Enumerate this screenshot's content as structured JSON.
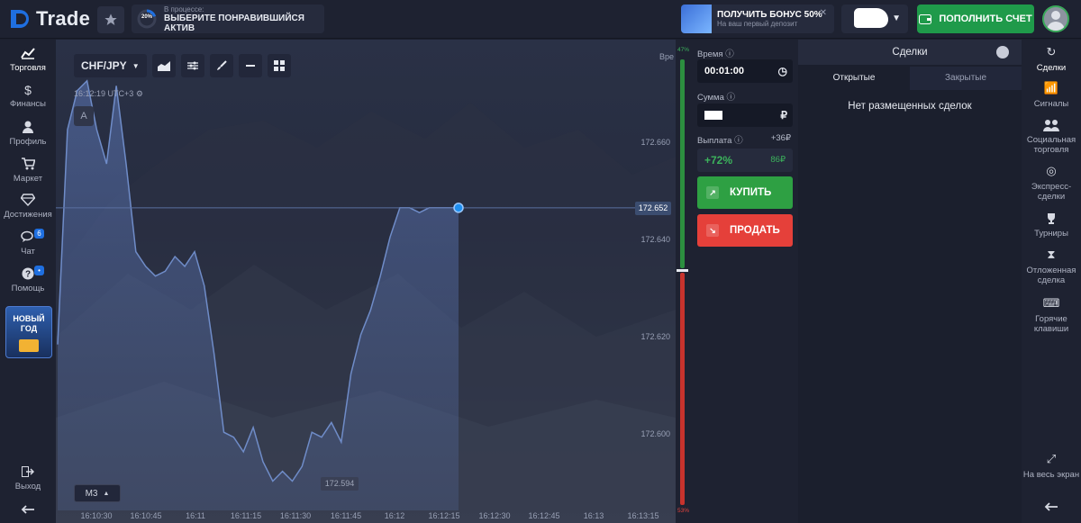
{
  "app": {
    "name": "Trade"
  },
  "header": {
    "progress": {
      "percent_label": "20%",
      "percent": 0.2,
      "subtitle": "В процессе:",
      "title": "ВЫБЕРИТЕ ПОНРАВИВШИЙСЯ АКТИВ"
    },
    "bonus": {
      "title": "ПОЛУЧИТЬ БОНУС 50%",
      "subtitle": "На ваш первый депозит",
      "close_icon": "close-icon"
    },
    "deposit_label": "ПОПОЛНИТЬ СЧЕТ"
  },
  "left_nav": {
    "items": [
      {
        "label": "Торговля",
        "icon": "chart-icon"
      },
      {
        "label": "Финансы",
        "icon": "dollar-icon"
      },
      {
        "label": "Профиль",
        "icon": "user-icon"
      },
      {
        "label": "Маркет",
        "icon": "cart-icon"
      },
      {
        "label": "Достижения",
        "icon": "diamond-icon"
      },
      {
        "label": "Чат",
        "icon": "chat-icon",
        "badge": "6"
      },
      {
        "label": "Помощь",
        "icon": "help-icon"
      }
    ],
    "promo": {
      "line1": "НОВЫЙ",
      "line2": "ГОД"
    },
    "logout_label": "Выход"
  },
  "chart": {
    "pair": "CHF/JPY",
    "time": "16:12:19 UTC+3",
    "indicator_btn": "A",
    "timeframe": "M3",
    "current_price": "172.652",
    "min_price": "172.594",
    "partial_label": "Вре",
    "y_ticks": [
      "172.660",
      "172.640",
      "172.620",
      "172.600"
    ],
    "x_ticks": [
      "16:10:30",
      "16:10:45",
      "16:11",
      "16:11:15",
      "16:11:30",
      "16:11:45",
      "16:12",
      "16:12:15",
      "16:12:30",
      "16:12:45",
      "16:13",
      "16:13:15"
    ]
  },
  "chart_data": {
    "type": "area",
    "title": "",
    "xlabel": "",
    "ylabel": "",
    "x": [
      "16:10:18",
      "16:10:20",
      "16:10:23",
      "16:10:26",
      "16:10:29",
      "16:10:32",
      "16:10:35",
      "16:10:38",
      "16:10:41",
      "16:10:44",
      "16:10:47",
      "16:10:50",
      "16:10:53",
      "16:10:56",
      "16:10:59",
      "16:11:02",
      "16:11:05",
      "16:11:08",
      "16:11:11",
      "16:11:14",
      "16:11:17",
      "16:11:20",
      "16:11:23",
      "16:11:26",
      "16:11:29",
      "16:11:32",
      "16:11:35",
      "16:11:38",
      "16:11:41",
      "16:11:44",
      "16:11:47",
      "16:11:50",
      "16:11:53",
      "16:11:56",
      "16:11:59",
      "16:12:02",
      "16:12:05",
      "16:12:08",
      "16:12:11",
      "16:12:14",
      "16:12:17",
      "16:12:19"
    ],
    "values": [
      172.624,
      172.668,
      172.676,
      172.678,
      172.668,
      172.661,
      172.677,
      172.661,
      172.643,
      172.64,
      172.638,
      172.639,
      172.642,
      172.64,
      172.643,
      172.636,
      172.622,
      172.606,
      172.605,
      172.602,
      172.607,
      172.6,
      172.596,
      172.598,
      172.596,
      172.599,
      172.606,
      172.605,
      172.608,
      172.604,
      172.618,
      172.626,
      172.631,
      172.638,
      172.646,
      172.652,
      172.652,
      172.651,
      172.652,
      172.652,
      172.652,
      172.652
    ],
    "ylim": [
      172.59,
      172.68
    ],
    "current": 172.652,
    "min_label": 172.594,
    "color": "#6f8cc8"
  },
  "sentiment": {
    "up": "47%",
    "down": "53%",
    "up_value": 0.47,
    "down_value": 0.53
  },
  "trade_panel": {
    "time_label": "Время",
    "time_value": "00:01:00",
    "amount_label": "Сумма",
    "payout_label": "Выплата",
    "payout_profit": "+36₽",
    "payout_percent": "+72%",
    "payout_amount": "86₽",
    "buy_label": "КУПИТЬ",
    "sell_label": "ПРОДАТЬ"
  },
  "deals": {
    "title": "Сделки",
    "tabs": [
      "Открытые",
      "Закрытые"
    ],
    "empty": "Нет размещенных сделок"
  },
  "right_nav": {
    "items": [
      {
        "label": "Сделки",
        "icon": "deals-icon"
      },
      {
        "label": "Сигналы",
        "icon": "signal-icon"
      },
      {
        "label": "Социальная торговля",
        "icon": "social-icon"
      },
      {
        "label": "Экспресс-сделки",
        "icon": "target-icon"
      },
      {
        "label": "Турниры",
        "icon": "trophy-icon"
      },
      {
        "label": "Отложенная сделка",
        "icon": "hourglass-icon"
      },
      {
        "label": "Горячие клавиши",
        "icon": "keyboard-icon"
      }
    ],
    "fullscreen": "На весь экран"
  },
  "colors": {
    "accent_green": "#2ea043",
    "accent_red": "#e5403a",
    "brand_blue": "#1f6fe0",
    "bg": "#1b1f2d"
  }
}
